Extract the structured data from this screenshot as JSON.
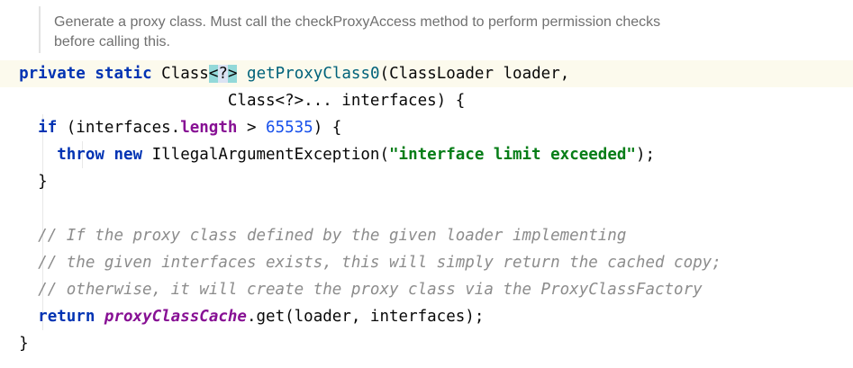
{
  "doc_comment": {
    "line1": "Generate a proxy class. Must call the checkProxyAccess method to perform permission checks",
    "line2": "before calling this."
  },
  "code": {
    "l1": {
      "kw_private": "private",
      "kw_static": "static",
      "type": "Class",
      "generic_open": "<",
      "generic_q": "?",
      "generic_close": ">",
      "method": "getProxyClass0",
      "params": "(ClassLoader loader,"
    },
    "l2": {
      "text": "Class<?>... interfaces) {"
    },
    "l3": {
      "kw_if": "if",
      "pre": " (interfaces.",
      "field": "length",
      "op": " > ",
      "num": "65535",
      "post": ") {"
    },
    "l4": {
      "kw_throw": "throw",
      "kw_new": "new",
      "cls": "IllegalArgumentException(",
      "str": "\"interface limit exceeded\"",
      "post": ");"
    },
    "l5": {
      "text": "}"
    },
    "l6": {
      "text": ""
    },
    "c1": "// If the proxy class defined by the given loader implementing",
    "c2": "// the given interfaces exists, this will simply return the cached copy;",
    "c3": "// otherwise, it will create the proxy class via the ProxyClassFactory",
    "l10": {
      "kw_return": "return",
      "static_field": "proxyClassCache",
      "post": ".get(loader, interfaces);"
    },
    "l11": {
      "text": "}"
    }
  },
  "colors": {
    "keyword": "#0033b3",
    "number": "#1750eb",
    "string": "#067d17",
    "comment": "#8c8c8c",
    "field": "#871094",
    "current_line": "#fcfaed",
    "bracket_highlight": "#93d9d9"
  }
}
